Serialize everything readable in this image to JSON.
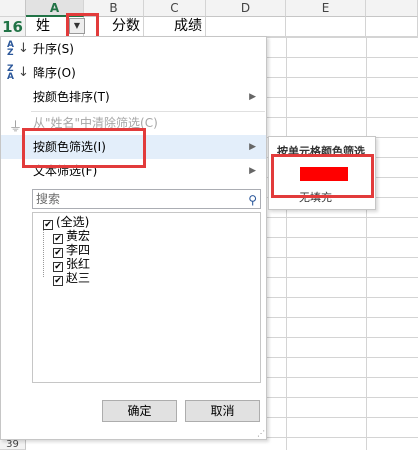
{
  "sheet": {
    "columns": [
      "A",
      "B",
      "C",
      "D",
      "E"
    ],
    "active_row": "16",
    "bottom_row": "39",
    "cells": {
      "a16": "姓",
      "b16": "分数",
      "c16": "成绩"
    }
  },
  "menu": {
    "sort_asc": "升序(S)",
    "sort_desc": "降序(O)",
    "sort_by_color": "按颜色排序(T)",
    "clear_filter": "从\"姓名\"中清除筛选(C)",
    "filter_by_color": "按颜色筛选(I)",
    "text_filter": "文本筛选(F)",
    "search_placeholder": "搜索",
    "items": [
      {
        "label": "(全选)",
        "checked": true
      },
      {
        "label": "黄宏",
        "checked": true
      },
      {
        "label": "李四",
        "checked": true
      },
      {
        "label": "张红",
        "checked": true
      },
      {
        "label": "赵三",
        "checked": true
      }
    ],
    "ok": "确定",
    "cancel": "取消"
  },
  "submenu": {
    "title": "按单元格颜色筛选",
    "swatch_color": "#ff0000",
    "no_fill": "无填充"
  },
  "colors": {
    "accent": "#217346",
    "highlight": "#e23b3b"
  }
}
